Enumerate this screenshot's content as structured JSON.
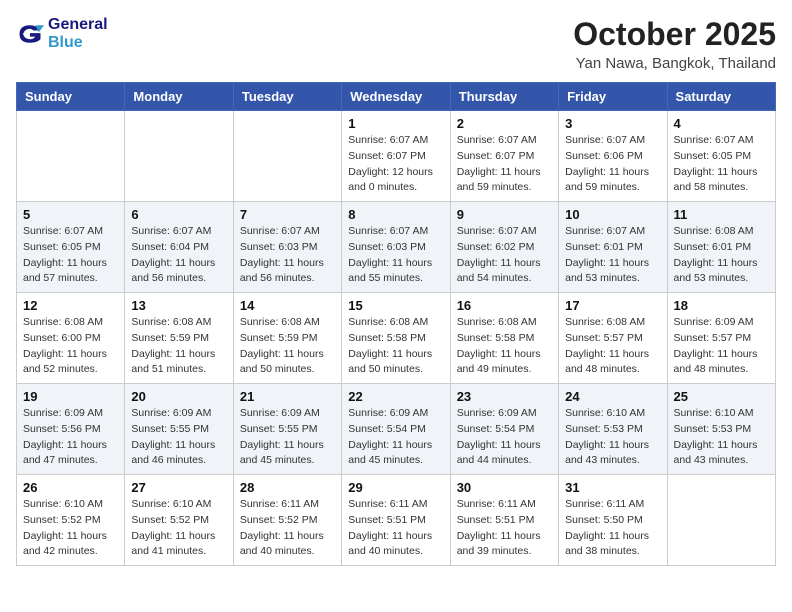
{
  "header": {
    "logo_general": "General",
    "logo_blue": "Blue",
    "month_title": "October 2025",
    "location": "Yan Nawa, Bangkok, Thailand"
  },
  "days_of_week": [
    "Sunday",
    "Monday",
    "Tuesday",
    "Wednesday",
    "Thursday",
    "Friday",
    "Saturday"
  ],
  "weeks": [
    [
      {
        "day": "",
        "info": ""
      },
      {
        "day": "",
        "info": ""
      },
      {
        "day": "",
        "info": ""
      },
      {
        "day": "1",
        "info": "Sunrise: 6:07 AM\nSunset: 6:07 PM\nDaylight: 12 hours\nand 0 minutes."
      },
      {
        "day": "2",
        "info": "Sunrise: 6:07 AM\nSunset: 6:07 PM\nDaylight: 11 hours\nand 59 minutes."
      },
      {
        "day": "3",
        "info": "Sunrise: 6:07 AM\nSunset: 6:06 PM\nDaylight: 11 hours\nand 59 minutes."
      },
      {
        "day": "4",
        "info": "Sunrise: 6:07 AM\nSunset: 6:05 PM\nDaylight: 11 hours\nand 58 minutes."
      }
    ],
    [
      {
        "day": "5",
        "info": "Sunrise: 6:07 AM\nSunset: 6:05 PM\nDaylight: 11 hours\nand 57 minutes."
      },
      {
        "day": "6",
        "info": "Sunrise: 6:07 AM\nSunset: 6:04 PM\nDaylight: 11 hours\nand 56 minutes."
      },
      {
        "day": "7",
        "info": "Sunrise: 6:07 AM\nSunset: 6:03 PM\nDaylight: 11 hours\nand 56 minutes."
      },
      {
        "day": "8",
        "info": "Sunrise: 6:07 AM\nSunset: 6:03 PM\nDaylight: 11 hours\nand 55 minutes."
      },
      {
        "day": "9",
        "info": "Sunrise: 6:07 AM\nSunset: 6:02 PM\nDaylight: 11 hours\nand 54 minutes."
      },
      {
        "day": "10",
        "info": "Sunrise: 6:07 AM\nSunset: 6:01 PM\nDaylight: 11 hours\nand 53 minutes."
      },
      {
        "day": "11",
        "info": "Sunrise: 6:08 AM\nSunset: 6:01 PM\nDaylight: 11 hours\nand 53 minutes."
      }
    ],
    [
      {
        "day": "12",
        "info": "Sunrise: 6:08 AM\nSunset: 6:00 PM\nDaylight: 11 hours\nand 52 minutes."
      },
      {
        "day": "13",
        "info": "Sunrise: 6:08 AM\nSunset: 5:59 PM\nDaylight: 11 hours\nand 51 minutes."
      },
      {
        "day": "14",
        "info": "Sunrise: 6:08 AM\nSunset: 5:59 PM\nDaylight: 11 hours\nand 50 minutes."
      },
      {
        "day": "15",
        "info": "Sunrise: 6:08 AM\nSunset: 5:58 PM\nDaylight: 11 hours\nand 50 minutes."
      },
      {
        "day": "16",
        "info": "Sunrise: 6:08 AM\nSunset: 5:58 PM\nDaylight: 11 hours\nand 49 minutes."
      },
      {
        "day": "17",
        "info": "Sunrise: 6:08 AM\nSunset: 5:57 PM\nDaylight: 11 hours\nand 48 minutes."
      },
      {
        "day": "18",
        "info": "Sunrise: 6:09 AM\nSunset: 5:57 PM\nDaylight: 11 hours\nand 48 minutes."
      }
    ],
    [
      {
        "day": "19",
        "info": "Sunrise: 6:09 AM\nSunset: 5:56 PM\nDaylight: 11 hours\nand 47 minutes."
      },
      {
        "day": "20",
        "info": "Sunrise: 6:09 AM\nSunset: 5:55 PM\nDaylight: 11 hours\nand 46 minutes."
      },
      {
        "day": "21",
        "info": "Sunrise: 6:09 AM\nSunset: 5:55 PM\nDaylight: 11 hours\nand 45 minutes."
      },
      {
        "day": "22",
        "info": "Sunrise: 6:09 AM\nSunset: 5:54 PM\nDaylight: 11 hours\nand 45 minutes."
      },
      {
        "day": "23",
        "info": "Sunrise: 6:09 AM\nSunset: 5:54 PM\nDaylight: 11 hours\nand 44 minutes."
      },
      {
        "day": "24",
        "info": "Sunrise: 6:10 AM\nSunset: 5:53 PM\nDaylight: 11 hours\nand 43 minutes."
      },
      {
        "day": "25",
        "info": "Sunrise: 6:10 AM\nSunset: 5:53 PM\nDaylight: 11 hours\nand 43 minutes."
      }
    ],
    [
      {
        "day": "26",
        "info": "Sunrise: 6:10 AM\nSunset: 5:52 PM\nDaylight: 11 hours\nand 42 minutes."
      },
      {
        "day": "27",
        "info": "Sunrise: 6:10 AM\nSunset: 5:52 PM\nDaylight: 11 hours\nand 41 minutes."
      },
      {
        "day": "28",
        "info": "Sunrise: 6:11 AM\nSunset: 5:52 PM\nDaylight: 11 hours\nand 40 minutes."
      },
      {
        "day": "29",
        "info": "Sunrise: 6:11 AM\nSunset: 5:51 PM\nDaylight: 11 hours\nand 40 minutes."
      },
      {
        "day": "30",
        "info": "Sunrise: 6:11 AM\nSunset: 5:51 PM\nDaylight: 11 hours\nand 39 minutes."
      },
      {
        "day": "31",
        "info": "Sunrise: 6:11 AM\nSunset: 5:50 PM\nDaylight: 11 hours\nand 38 minutes."
      },
      {
        "day": "",
        "info": ""
      }
    ]
  ]
}
